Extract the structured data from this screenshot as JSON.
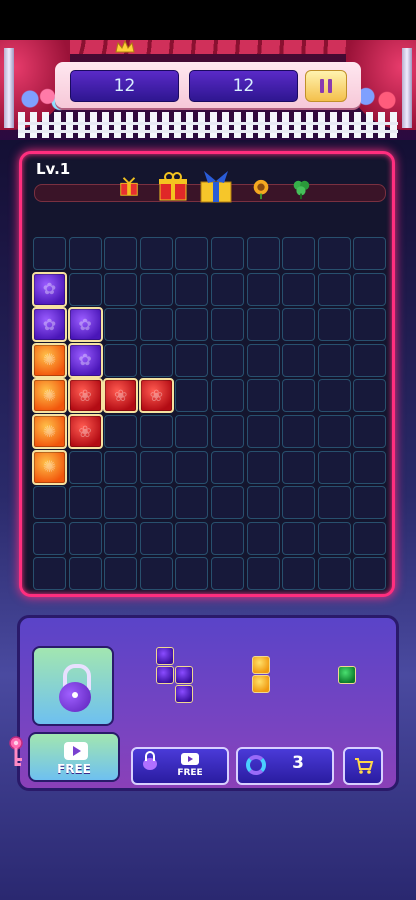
{
  "header": {
    "score_current": "12",
    "score_best": "12"
  },
  "level": {
    "label": "Lv.1",
    "rewards": [
      "gift-box-small",
      "gift-box",
      "gift-box-bow",
      "sunflower",
      "green-clover"
    ]
  },
  "board": {
    "cols": 10,
    "rows": 10,
    "blocks": [
      {
        "col": 0,
        "row": 1,
        "color": "purple"
      },
      {
        "col": 0,
        "row": 2,
        "color": "purple"
      },
      {
        "col": 1,
        "row": 2,
        "color": "purple"
      },
      {
        "col": 0,
        "row": 3,
        "color": "orange"
      },
      {
        "col": 1,
        "row": 3,
        "color": "purple"
      },
      {
        "col": 0,
        "row": 4,
        "color": "orange"
      },
      {
        "col": 1,
        "row": 4,
        "color": "red"
      },
      {
        "col": 2,
        "row": 4,
        "color": "red"
      },
      {
        "col": 3,
        "row": 4,
        "color": "red"
      },
      {
        "col": 0,
        "row": 5,
        "color": "orange"
      },
      {
        "col": 1,
        "row": 5,
        "color": "red"
      },
      {
        "col": 0,
        "row": 6,
        "color": "orange"
      }
    ]
  },
  "tray": {
    "free_label": "FREE",
    "lock_free_label": "FREE",
    "refresh_count": "3",
    "pieces": [
      {
        "color": "purple",
        "cells": [
          [
            0,
            0
          ],
          [
            0,
            1
          ],
          [
            1,
            1
          ],
          [
            1,
            2
          ]
        ]
      },
      {
        "color": "yellow",
        "cells": [
          [
            0,
            0
          ],
          [
            0,
            1
          ]
        ]
      },
      {
        "color": "green",
        "cells": [
          [
            0,
            0
          ]
        ]
      }
    ]
  },
  "colors": {
    "board_border": "#ff2e7e",
    "purple": "#5a20c8",
    "orange": "#f2700c",
    "red": "#c81420"
  },
  "icons": [
    "crown-icon",
    "pause-icon",
    "lock-icon",
    "play-icon",
    "key-icon",
    "refresh-icon",
    "cart-icon"
  ]
}
